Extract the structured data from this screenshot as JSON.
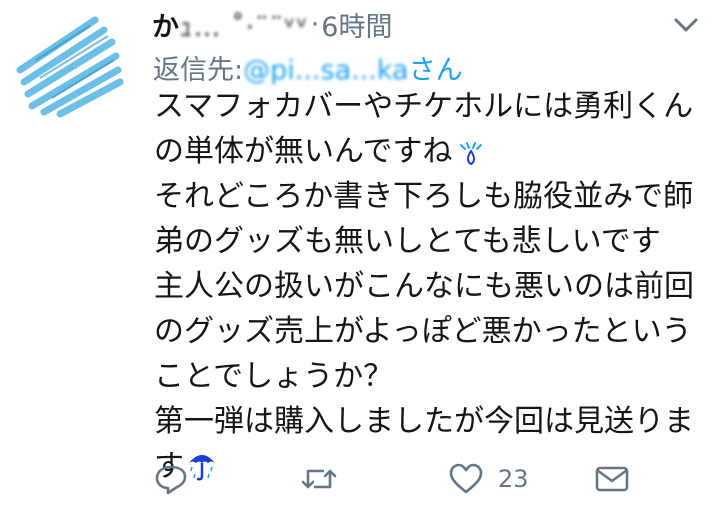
{
  "tweet": {
    "handle_visible": "か",
    "handle_blurred": "ｭ… ˚·¨¨ᵛᵛ",
    "separator": "·",
    "time": "6時間",
    "reply_prefix": "返信先: ",
    "reply_user_blurred": "@pi...sa...ka",
    "reply_suffix": "さん",
    "text_lines": [
      "スマフォカバーやチケホルには勇利くん",
      "の単体が無いんですね",
      "それどころか書き下ろしも脇役並みで師",
      "弟のグッズも無いしとても悲しいです",
      "主人公の扱いがこんなにも悪いのは前回",
      "のグッズ売上がよっぽど悪かったという",
      "ことでしょうか？",
      "第一弾は購入しましたが今回は見送りま",
      "す"
    ],
    "like_count": "23"
  },
  "icons": {
    "menu": "chevron-down-icon",
    "emoji_1": "sweat-drop-emoji-icon",
    "emoji_2": "umbrella-rain-emoji-icon",
    "reply": "reply-icon",
    "retweet": "retweet-icon",
    "like": "heart-icon",
    "share": "share-envelope-icon"
  },
  "colors": {
    "link": "#1da1f2",
    "muted": "#657786",
    "text": "#14171a",
    "avatar_stripe": "#5cb8e4",
    "umbrella": "#1a3ddb"
  }
}
